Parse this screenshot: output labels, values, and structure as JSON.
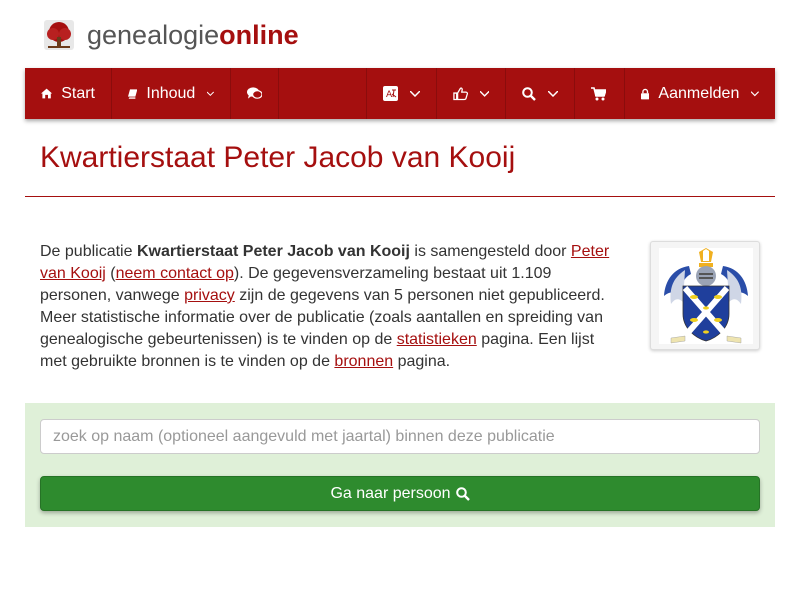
{
  "brand": {
    "part1": "genealogie",
    "part2": "online",
    "logo_icon": "tree-icon"
  },
  "nav": {
    "start": {
      "label": "Start",
      "icon": "home-icon"
    },
    "inhoud": {
      "label": "Inhoud",
      "icon": "book-icon"
    },
    "comments": {
      "icon": "comments-icon"
    },
    "language": {
      "icon": "language-icon"
    },
    "share": {
      "icon": "thumbs-up-icon"
    },
    "search": {
      "icon": "search-icon"
    },
    "cart": {
      "icon": "cart-icon"
    },
    "login": {
      "label": "Aanmelden",
      "icon": "lock-icon"
    }
  },
  "page": {
    "title": "Kwartierstaat Peter Jacob van Kooij"
  },
  "intro": {
    "t1": "De publicatie ",
    "pub_name": "Kwartierstaat Peter Jacob van Kooij",
    "t2": " is samengesteld door ",
    "author_link": "Peter van Kooij",
    "t3": " (",
    "contact_link": "neem contact op",
    "t4": "). De gegevensverzameling bestaat uit 1.109 personen, vanwege ",
    "privacy_link": "privacy",
    "t5": " zijn de gegevens van 5 personen niet gepubliceerd. Meer statistische informatie over de publicatie (zoals aantallen en spreiding van genealogische gebeurtenissen) is te vinden op de ",
    "stats_link": "statistieken",
    "t6": " pagina. Een lijst met gebruikte bronnen is te vinden op de ",
    "sources_link": "bronnen",
    "t7": " pagina."
  },
  "search": {
    "placeholder": "zoek op naam (optioneel aangevuld met jaartal) binnen deze publicatie",
    "value": "",
    "button_label": "Ga naar persoon"
  },
  "colors": {
    "brand_red": "#a50f0f",
    "search_panel": "#dff0d8",
    "button_green": "#2e8b2e"
  }
}
